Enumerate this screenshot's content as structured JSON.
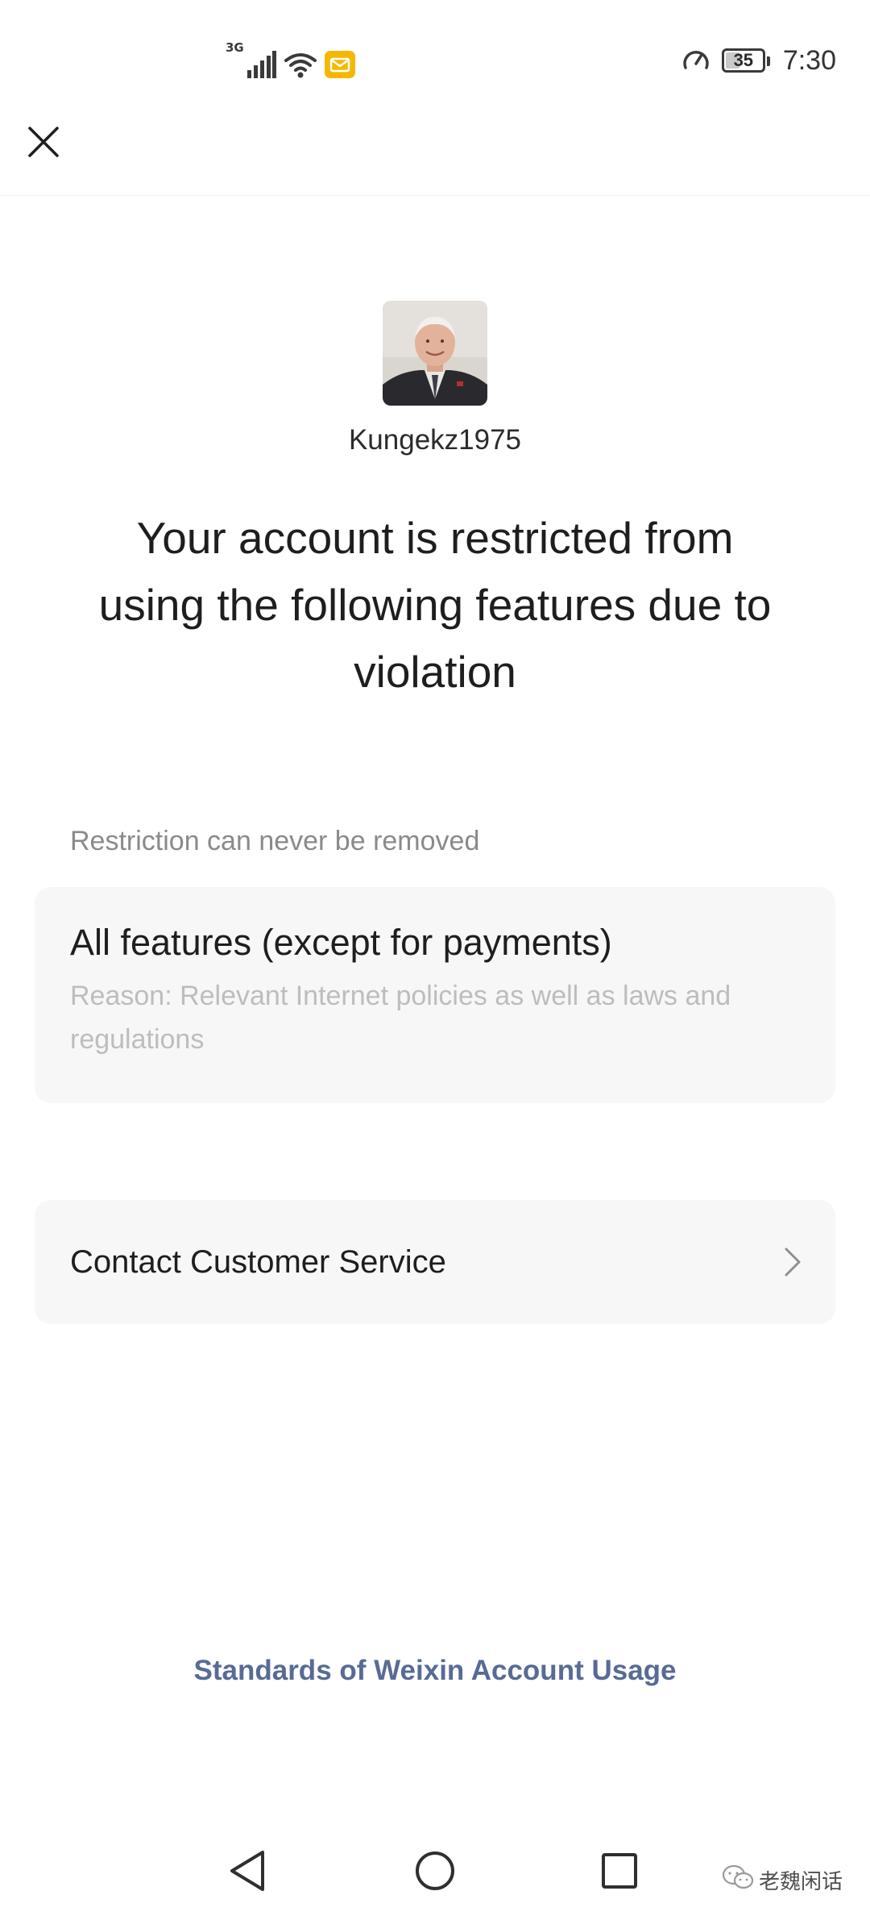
{
  "status_bar": {
    "network_type": "3G",
    "battery_level": "35",
    "battery_fraction": 0.35,
    "time": "7:30",
    "icons": [
      "signal-icon",
      "wifi-icon",
      "mail-notification-icon",
      "speed-icon",
      "battery-icon"
    ]
  },
  "header": {
    "close_icon": "close-icon"
  },
  "profile": {
    "username": "Kungekz1975"
  },
  "title": "Your account is restricted from using the following features due to violation",
  "restriction": {
    "caption": "Restriction can never be removed",
    "feature": "All features (except for payments)",
    "reason": "Reason: Relevant Internet policies as well as laws and regulations"
  },
  "contact": {
    "label": "Contact Customer Service",
    "icon": "chevron-right-icon"
  },
  "footer": {
    "link": "Standards of Weixin Account Usage"
  },
  "nav": {
    "icons": [
      "back-icon",
      "home-icon",
      "recents-icon"
    ]
  },
  "watermark": {
    "text": "老魏闲话"
  },
  "colors": {
    "link": "#576b95",
    "card_bg": "#f7f7f7",
    "caption": "#8a8a8a",
    "reason": "#bdbdbd",
    "mail_badge": "#f5b800"
  }
}
